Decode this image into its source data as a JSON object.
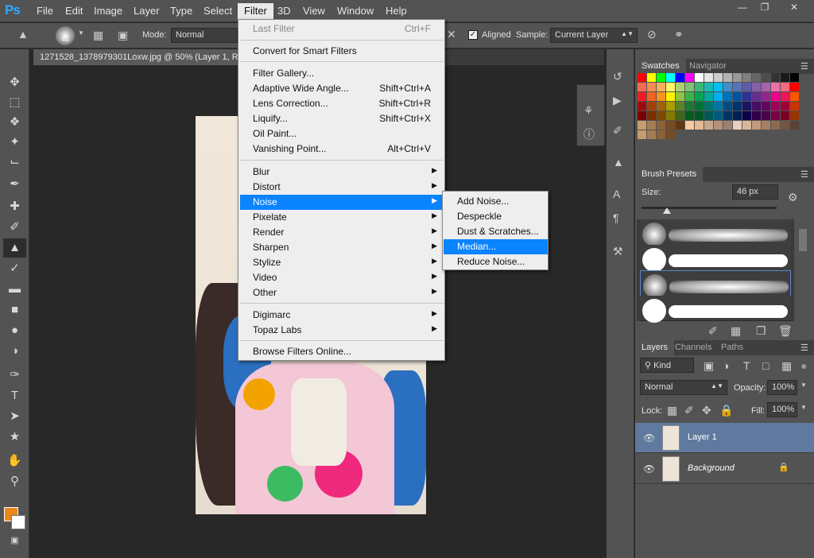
{
  "app": {
    "logo": "Ps"
  },
  "menubar": {
    "items": [
      "File",
      "Edit",
      "Image",
      "Layer",
      "Type",
      "Select",
      "Filter",
      "3D",
      "View",
      "Window",
      "Help"
    ],
    "active": "Filter"
  },
  "options": {
    "brush_size": "46",
    "mode_label": "Mode:",
    "mode_value": "Normal",
    "aligned_label": "Aligned",
    "sample_label": "Sample:",
    "sample_value": "Current Layer"
  },
  "document": {
    "tab_title": "1271528_1378979301Loxw.jpg @ 50% (Layer 1, R"
  },
  "filter_menu": {
    "last_filter": {
      "label": "Last Filter",
      "shortcut": "Ctrl+F"
    },
    "smart": "Convert for Smart Filters",
    "g1": [
      {
        "label": "Filter Gallery...",
        "shortcut": ""
      },
      {
        "label": "Adaptive Wide Angle...",
        "shortcut": "Shift+Ctrl+A"
      },
      {
        "label": "Lens Correction...",
        "shortcut": "Shift+Ctrl+R"
      },
      {
        "label": "Liquify...",
        "shortcut": "Shift+Ctrl+X"
      },
      {
        "label": "Oil Paint...",
        "shortcut": ""
      },
      {
        "label": "Vanishing Point...",
        "shortcut": "Alt+Ctrl+V"
      }
    ],
    "g2": [
      "Blur",
      "Distort",
      "Noise",
      "Pixelate",
      "Render",
      "Sharpen",
      "Stylize",
      "Video",
      "Other"
    ],
    "g2_highlight": "Noise",
    "g3": [
      "Digimarc",
      "Topaz Labs"
    ],
    "browse": "Browse Filters Online..."
  },
  "noise_submenu": {
    "items": [
      "Add Noise...",
      "Despeckle",
      "Dust & Scratches...",
      "Median...",
      "Reduce Noise..."
    ],
    "highlight": "Median..."
  },
  "swatches_panel": {
    "tabs": [
      "Swatches",
      "Navigator"
    ],
    "colors": [
      "#ff0000",
      "#ffff00",
      "#00ff00",
      "#00ffff",
      "#0000ff",
      "#ff00ff",
      "#ffffff",
      "#e6e6e6",
      "#cccccc",
      "#b3b3b3",
      "#999999",
      "#808080",
      "#666666",
      "#4d4d4d",
      "#333333",
      "#1a1a1a",
      "#000000",
      "#f26c4f",
      "#f68e56",
      "#fbaf5c",
      "#fff467",
      "#acd372",
      "#7cc576",
      "#3bb878",
      "#1abbb4",
      "#00bff3",
      "#438ccb",
      "#5574b9",
      "#605ca8",
      "#855fa8",
      "#a763a9",
      "#ef6ea8",
      "#f16d7e",
      "#ff0000",
      "#ed1c24",
      "#f26522",
      "#f7941d",
      "#fff200",
      "#8dc63f",
      "#39b54a",
      "#00a651",
      "#00a99d",
      "#00aeef",
      "#0072bc",
      "#0054a6",
      "#2e3192",
      "#662d91",
      "#92278f",
      "#ec008c",
      "#ed145b",
      "#ff5500",
      "#9e0b0f",
      "#a0410d",
      "#a36209",
      "#aba000",
      "#598527",
      "#1a7b30",
      "#007236",
      "#00746b",
      "#0076a3",
      "#004b80",
      "#003471",
      "#1b1464",
      "#440e62",
      "#630460",
      "#9e005d",
      "#9e0039",
      "#cc3300",
      "#790000",
      "#7b2e00",
      "#7d4900",
      "#827b00",
      "#406618",
      "#005e20",
      "#005826",
      "#005952",
      "#005b7f",
      "#003663",
      "#002157",
      "#0d004c",
      "#32004b",
      "#4b0049",
      "#7b0046",
      "#7a0026",
      "#993300",
      "#c69c6d",
      "#a67c52",
      "#8c6239",
      "#754c24",
      "#603913",
      "#f6c9a0",
      "#e5b896",
      "#c7a88a",
      "#b5917a",
      "#9b8270",
      "#e6cfbe",
      "#d8b79b",
      "#c19a7b",
      "#a77f62",
      "#8c6a52",
      "#735543",
      "#5a4235",
      "#c69c6d",
      "#a67c52",
      "#8c6239",
      "#754c24"
    ]
  },
  "brush_presets": {
    "title": "Brush Presets",
    "size_label": "Size:",
    "size_value": "46 px",
    "slider_fraction": 0.19
  },
  "layers_panel": {
    "tabs": [
      "Layers",
      "Channels",
      "Paths"
    ],
    "kind": "Kind",
    "blend_mode": "Normal",
    "opacity_label": "Opacity:",
    "opacity_value": "100%",
    "lock_label": "Lock:",
    "fill_label": "Fill:",
    "fill_value": "100%",
    "layers": [
      {
        "name": "Layer 1",
        "selected": true
      },
      {
        "name": "Background",
        "selected": false
      }
    ]
  }
}
